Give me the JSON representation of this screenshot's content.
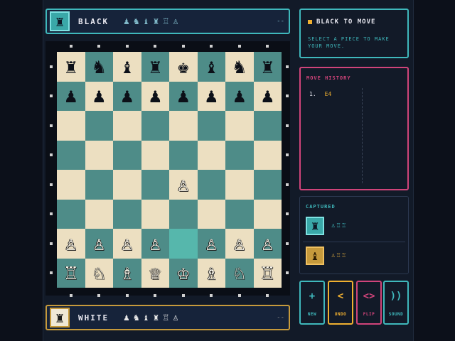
{
  "players": {
    "black": {
      "name": "BLACK",
      "avatar": "♜",
      "captured": [
        "♟",
        "♞",
        "♝",
        "♜",
        "♖",
        "♙"
      ],
      "timer": "--"
    },
    "white": {
      "name": "WHITE",
      "avatar": "♜",
      "captured": [
        "♟",
        "♞",
        "♝",
        "♜",
        "♖",
        "♙"
      ],
      "timer": "--"
    }
  },
  "status": {
    "title": "BLACK TO MOVE",
    "subtitle": "SELECT A PIECE TO MAKE YOUR MOVE."
  },
  "history": {
    "title": "MOVE HISTORY",
    "moves": [
      {
        "num": "1.",
        "white": "E4",
        "black": ""
      }
    ]
  },
  "captured": {
    "title": "CAPTURED",
    "black_icon": "♜",
    "white_icon": "♝",
    "black_list": "♙♖♖",
    "white_list": "♙♖♖"
  },
  "controls": {
    "new": {
      "icon": "+",
      "label": "NEW"
    },
    "undo": {
      "icon": "<",
      "label": "UNDO"
    },
    "flip": {
      "icon": "<>",
      "label": "FLIP"
    },
    "sound": {
      "icon": "))",
      "label": "SOUND"
    }
  },
  "board": {
    "highlight": [
      4,
      6
    ],
    "rows": [
      [
        "♜",
        "♞",
        "♝",
        "♜",
        "♚",
        "♝",
        "♞",
        "♜"
      ],
      [
        "♟",
        "♟",
        "♟",
        "♟",
        "♟",
        "♟",
        "♟",
        "♟"
      ],
      [
        "",
        "",
        "",
        "",
        "",
        "",
        "",
        ""
      ],
      [
        "",
        "",
        "",
        "",
        "",
        "",
        "",
        ""
      ],
      [
        "",
        "",
        "",
        "",
        "♙",
        "",
        "",
        ""
      ],
      [
        "",
        "",
        "",
        "",
        "",
        "",
        "",
        ""
      ],
      [
        "♙",
        "♙",
        "♙",
        "♙",
        "",
        "♙",
        "♙",
        "♙"
      ],
      [
        "♖",
        "♘",
        "♗",
        "♕",
        "♔",
        "♗",
        "♘",
        "♖"
      ]
    ],
    "colors": {
      "light": "#ecdfc1",
      "dark": "#4e8c88",
      "highlight": "#56b7ac"
    }
  }
}
